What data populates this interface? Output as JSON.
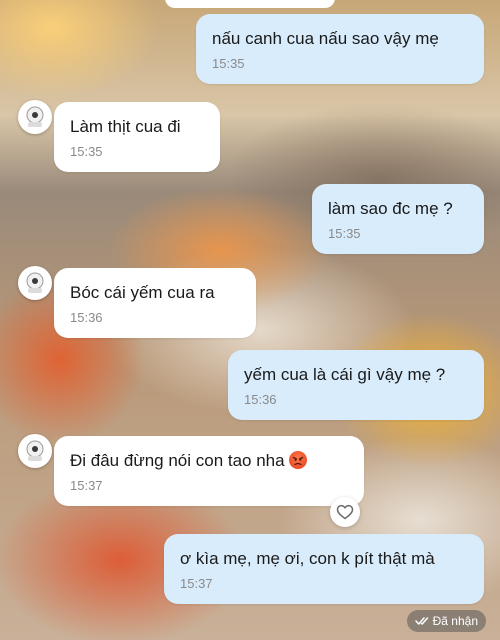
{
  "messages": [
    {
      "text": "nấu canh cua nấu sao vậy mẹ",
      "time": "15:35"
    },
    {
      "text": "Làm thịt cua đi",
      "time": "15:35"
    },
    {
      "text": "làm sao đc mẹ ?",
      "time": "15:35"
    },
    {
      "text": "Bóc cái yếm cua ra",
      "time": "15:36"
    },
    {
      "text": "yếm cua là cái gì vậy mẹ ?",
      "time": "15:36"
    },
    {
      "text": "Đi đâu đừng nói con tao nha",
      "time": "15:37"
    },
    {
      "text": "ơ kìa mẹ, mẹ ơi, con k pít thật mà",
      "time": "15:37"
    }
  ],
  "status": {
    "label": "Đã nhận"
  },
  "icons": {
    "avatar": "avatar-icon",
    "angry_emoji": "angry-face-icon",
    "react": "heart-icon",
    "status": "double-check-icon"
  },
  "colors": {
    "outgoing_bubble": "#d8ecfc",
    "incoming_bubble": "#ffffff"
  }
}
